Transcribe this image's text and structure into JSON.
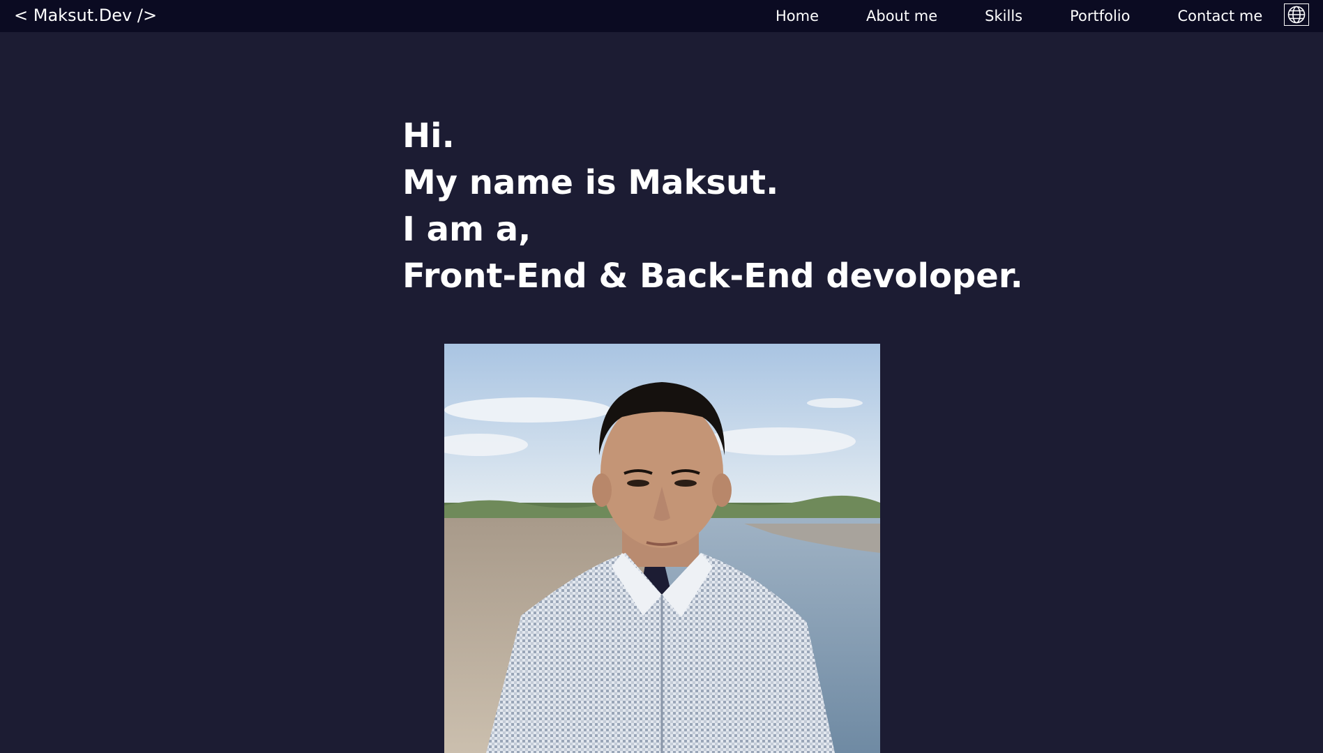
{
  "navbar": {
    "logo": "< Maksut.Dev />",
    "links": [
      {
        "label": "Home"
      },
      {
        "label": "About me"
      },
      {
        "label": "Skills"
      },
      {
        "label": "Portfolio"
      },
      {
        "label": "Contact me"
      }
    ],
    "language_icon": "globe-icon"
  },
  "hero": {
    "lines": [
      "Hi.",
      "My name is Maksut.",
      "I am a,",
      "Front-End & Back-End devoloper."
    ]
  },
  "colors": {
    "page_background": "#1c1c33",
    "navbar_background": "#0b0b22",
    "text": "#ffffff"
  }
}
